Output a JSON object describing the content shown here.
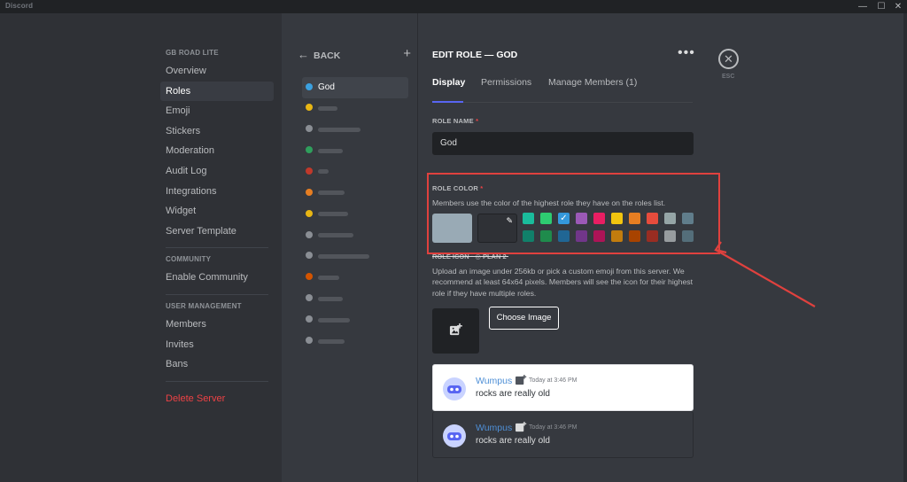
{
  "window": {
    "title": "Discord",
    "controls": [
      "—",
      "☐",
      "✕"
    ]
  },
  "sidebar": {
    "server_name": "GB ROAD LITE",
    "items": [
      {
        "label": "Overview"
      },
      {
        "label": "Roles",
        "active": true
      },
      {
        "label": "Emoji"
      },
      {
        "label": "Stickers"
      },
      {
        "label": "Moderation"
      },
      {
        "label": "Audit Log"
      },
      {
        "label": "Integrations"
      },
      {
        "label": "Widget"
      },
      {
        "label": "Server Template"
      }
    ],
    "community_header": "COMMUNITY",
    "community_items": [
      {
        "label": "Enable Community"
      }
    ],
    "user_mgmt_header": "USER MANAGEMENT",
    "user_mgmt_items": [
      {
        "label": "Members"
      },
      {
        "label": "Invites"
      },
      {
        "label": "Bans"
      }
    ],
    "delete_label": "Delete Server"
  },
  "role_list": {
    "back_label": "BACK",
    "add_icon": "plus-icon",
    "roles": [
      {
        "name": "God",
        "color": "#3ba1e0",
        "active": true
      },
      {
        "color": "#e8b614",
        "blurred": true
      },
      {
        "color": "#8a8e94",
        "blurred": true
      },
      {
        "color": "#2f9e5c",
        "blurred": true
      },
      {
        "color": "#c0392b",
        "blurred": true
      },
      {
        "color": "#e67e22",
        "blurred": true
      },
      {
        "color": "#e8b614",
        "blurred": true
      },
      {
        "color": "#8a8e94",
        "blurred": true
      },
      {
        "color": "#8a8e94",
        "blurred": true
      },
      {
        "color": "#d35400",
        "blurred": true
      },
      {
        "color": "#8a8e94",
        "blurred": true
      },
      {
        "color": "#8a8e94",
        "blurred": true
      },
      {
        "color": "#8a8e94",
        "blurred": true
      }
    ]
  },
  "editor": {
    "title": "EDIT ROLE — GOD",
    "more_label": "•••",
    "close_label": "ESC",
    "tabs": [
      {
        "label": "Display",
        "active": true
      },
      {
        "label": "Permissions"
      },
      {
        "label": "Manage Members (1)"
      }
    ],
    "role_name_label": "ROLE NAME",
    "required_mark": "*",
    "role_name_value": "God",
    "role_color_label": "ROLE COLOR",
    "role_color_desc": "Members use the color of the highest role they have on the roles list.",
    "default_color": "#99aab5",
    "swatches_top": [
      "#1abc9c",
      "#2ecc71",
      "#3498db",
      "#9b59b6",
      "#e91e63",
      "#f1c40f",
      "#e67e22",
      "#e74c3c",
      "#95a5a6",
      "#607d8b"
    ],
    "swatches_bottom": [
      "#11806a",
      "#1f8b4c",
      "#206694",
      "#71368a",
      "#ad1457",
      "#c27c0e",
      "#a84300",
      "#992d22",
      "#979c9f",
      "#546e7a"
    ],
    "selected_swatch_index": 2,
    "role_icon_label": "ROLE ICON · ◎ PLAN 2",
    "role_icon_desc": "Upload an image under 256kb or pick a custom emoji from this server. We recommend at least 64x64 pixels. Members will see the icon for their highest role if they have multiple roles.",
    "choose_image_label": "Choose Image",
    "preview": {
      "username": "Wumpus",
      "timestamp": "Today at 3:46 PM",
      "message": "rocks are really old",
      "name_color": "#4e8fd6"
    }
  },
  "annotation": {
    "box_color": "#e0413e"
  }
}
